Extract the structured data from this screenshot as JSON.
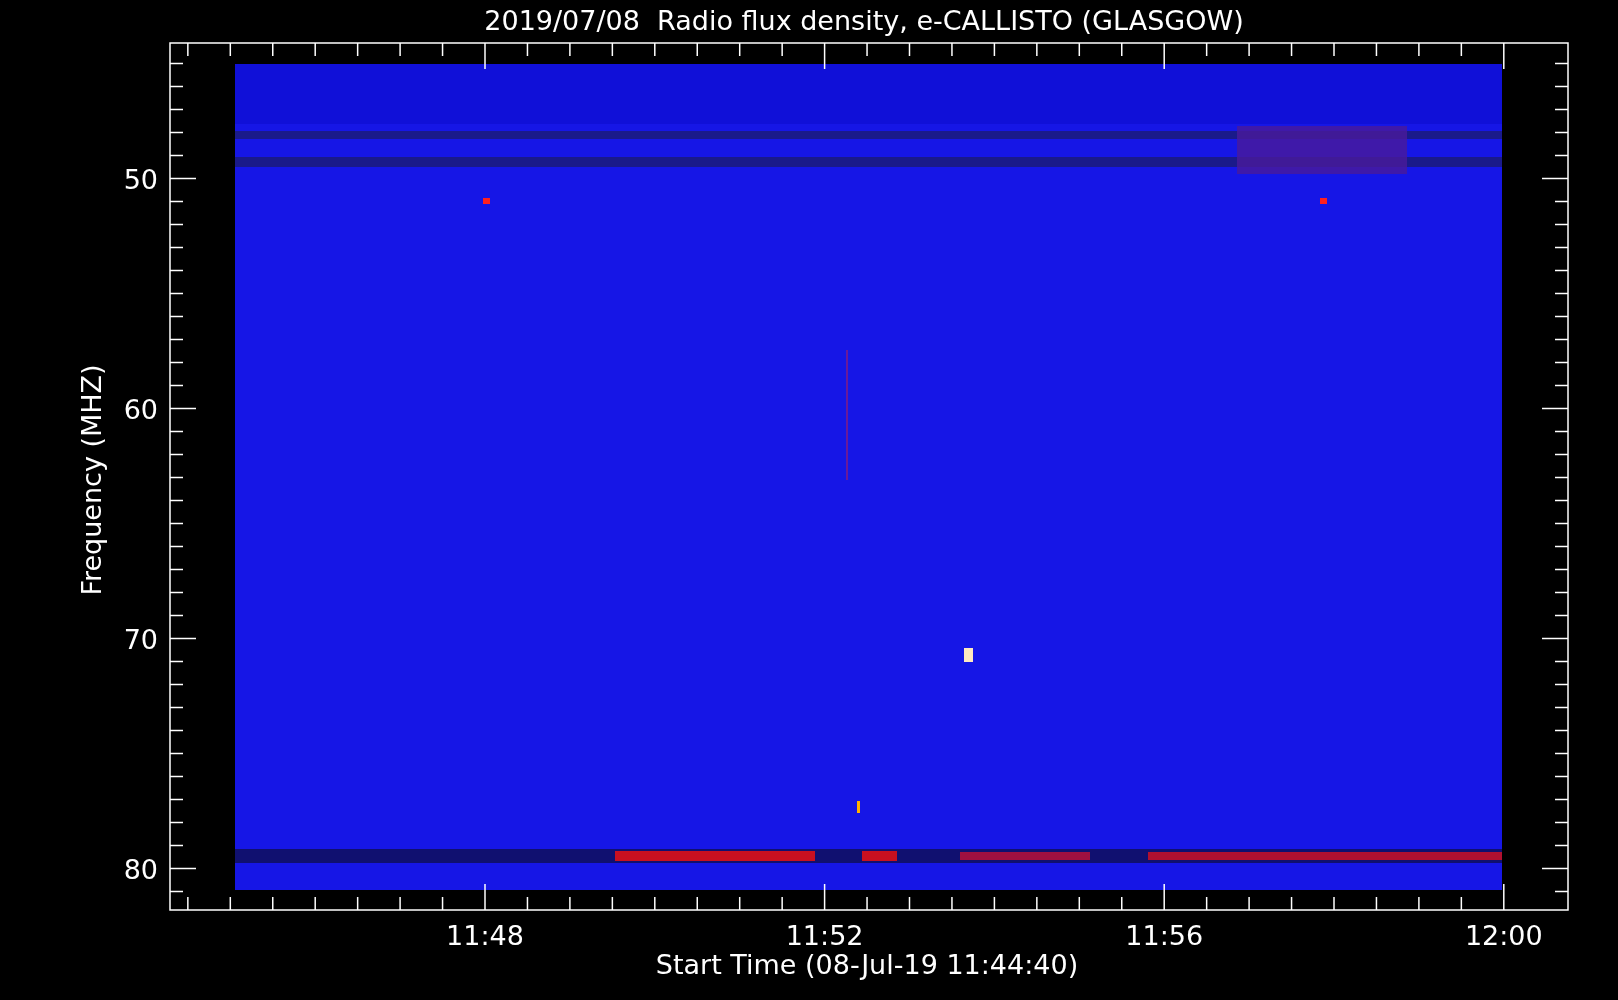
{
  "plot": {
    "title": "2019/07/08  Radio flux density, e-CALLISTO (GLASGOW)",
    "ylabel": "Frequency (MHZ)",
    "xlabel": "Start Time (08-Jul-19 11:44:40)",
    "yticks": [
      "50",
      "60",
      "70",
      "80"
    ],
    "xticks": [
      "11:48",
      "11:52",
      "11:56",
      "12:00"
    ]
  }
}
